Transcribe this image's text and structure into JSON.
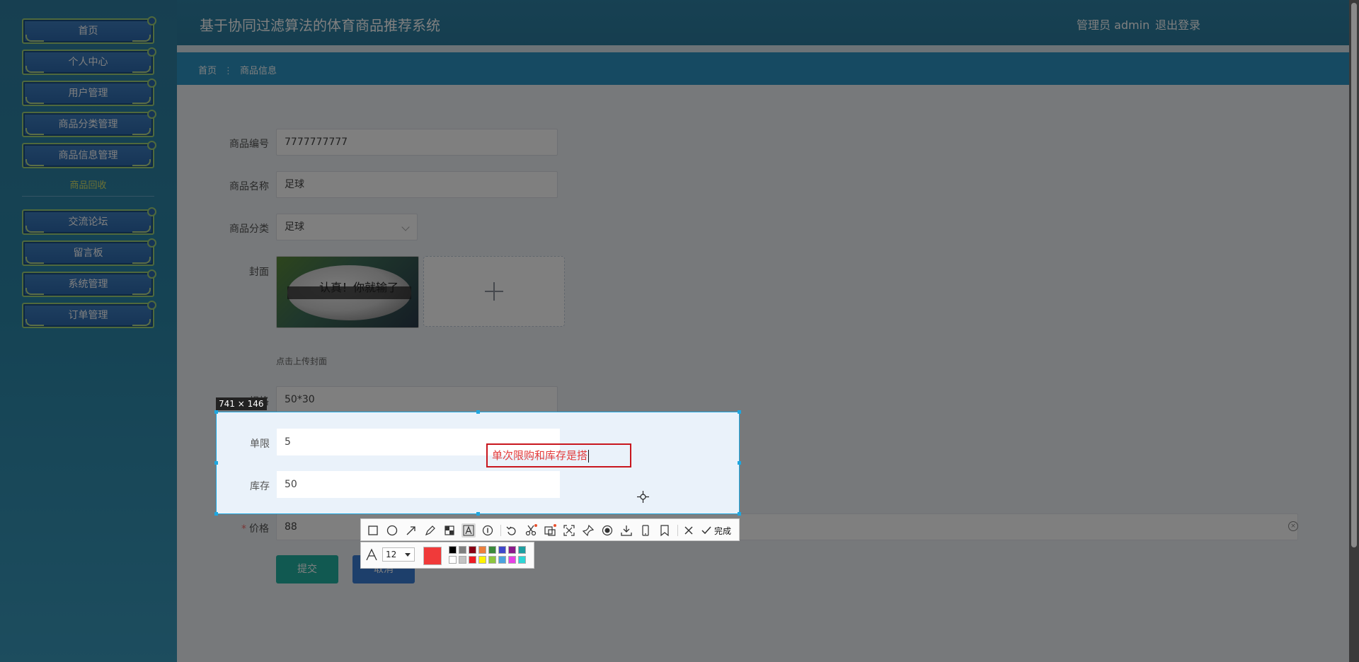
{
  "app": {
    "title": "基于协同过滤算法的体育商品推荐系统",
    "user_label": "管理员 admin",
    "logout_label": "退出登录"
  },
  "sidebar": {
    "items": [
      {
        "label": "首页"
      },
      {
        "label": "个人中心"
      },
      {
        "label": "用户管理"
      },
      {
        "label": "商品分类管理"
      },
      {
        "label": "商品信息管理"
      },
      {
        "label": "交流论坛"
      },
      {
        "label": "留言板"
      },
      {
        "label": "系统管理"
      },
      {
        "label": "订单管理"
      }
    ],
    "submenu_label": "商品回收"
  },
  "breadcrumb": {
    "home": "首页",
    "separator": "⋮",
    "current": "商品信息"
  },
  "form": {
    "code": {
      "label": "商品编号",
      "value": "7777777777"
    },
    "name": {
      "label": "商品名称",
      "value": "足球"
    },
    "category": {
      "label": "商品分类",
      "value": "足球"
    },
    "cover": {
      "label": "封面",
      "hint": "点击上传封面",
      "image_text": "认真！你就输了"
    },
    "spec": {
      "label": "规格",
      "value": "50*30"
    },
    "limit": {
      "label": "单限",
      "value": "5"
    },
    "stock": {
      "label": "库存",
      "value": "50"
    },
    "price": {
      "label": "价格",
      "value": "88",
      "required_mark": "*"
    },
    "submit_label": "提交",
    "reset_label": "取消"
  },
  "capture": {
    "size_label": "741 × 146",
    "annotation_text": "单次限购和库存是搭"
  },
  "toolbar": {
    "done_label": "完成",
    "font_size": "12",
    "current_color": "#f03a3a",
    "palette_top": [
      "#000000",
      "#7f7f7f",
      "#880015",
      "#ed7f3c",
      "#3b8a3b",
      "#3f48cc",
      "#8b1a8b",
      "#1e9ea0"
    ],
    "palette_bottom": [
      "#ffffff",
      "#c3c3c3",
      "#ed1c24",
      "#fff200",
      "#8dc63f",
      "#4aa3df",
      "#e640e6",
      "#2ed6d6"
    ]
  }
}
